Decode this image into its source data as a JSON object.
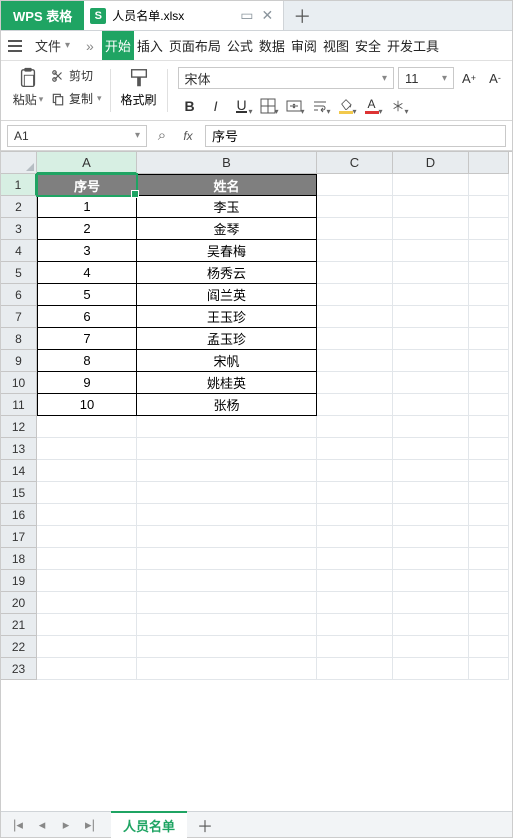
{
  "app": {
    "name": "WPS 表格"
  },
  "file_tab": {
    "icon_letter": "S",
    "name": "人员名单.xlsx"
  },
  "menus": {
    "file": "文件",
    "tabs": [
      "开始",
      "插入",
      "页面布局",
      "公式",
      "数据",
      "审阅",
      "视图",
      "安全",
      "开发工具"
    ],
    "active_index": 0
  },
  "ribbon": {
    "paste": "粘贴",
    "cut": "剪切",
    "copy": "复制",
    "format_painter": "格式刷",
    "font_name": "宋体",
    "font_size": "11"
  },
  "namebox": {
    "value": "A1"
  },
  "formula": {
    "value": "序号"
  },
  "columns": [
    "A",
    "B",
    "C",
    "D",
    ""
  ],
  "active_col_index": 0,
  "rows": [
    1,
    2,
    3,
    4,
    5,
    6,
    7,
    8,
    9,
    10,
    11,
    12,
    13,
    14,
    15,
    16,
    17,
    18,
    19,
    20,
    21,
    22,
    23
  ],
  "active_row_index": 0,
  "table": {
    "headers": [
      "序号",
      "姓名"
    ],
    "data": [
      [
        "1",
        "李玉"
      ],
      [
        "2",
        "金琴"
      ],
      [
        "3",
        "吴春梅"
      ],
      [
        "4",
        "杨秀云"
      ],
      [
        "5",
        "阎兰英"
      ],
      [
        "6",
        "王玉珍"
      ],
      [
        "7",
        "孟玉珍"
      ],
      [
        "8",
        "宋帆"
      ],
      [
        "9",
        "姚桂英"
      ],
      [
        "10",
        "张杨"
      ]
    ]
  },
  "sheet_tab": {
    "name": "人员名单"
  },
  "chart_data": {
    "type": "table",
    "title": "人员名单",
    "columns": [
      "序号",
      "姓名"
    ],
    "rows": [
      [
        1,
        "李玉"
      ],
      [
        2,
        "金琴"
      ],
      [
        3,
        "吴春梅"
      ],
      [
        4,
        "杨秀云"
      ],
      [
        5,
        "阎兰英"
      ],
      [
        6,
        "王玉珍"
      ],
      [
        7,
        "孟玉珍"
      ],
      [
        8,
        "宋帆"
      ],
      [
        9,
        "姚桂英"
      ],
      [
        10,
        "张杨"
      ]
    ]
  }
}
